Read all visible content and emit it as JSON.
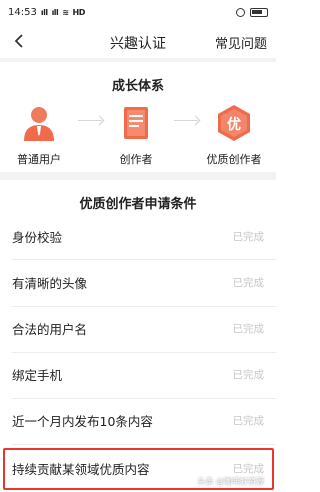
{
  "status_bar": {
    "time": "14:53",
    "signal_1": "ᵢll",
    "signal_2": "ᵢll",
    "network": "HD"
  },
  "nav": {
    "title": "兴趣认证",
    "faq": "常见问题"
  },
  "growth": {
    "title": "成长体系",
    "stages": [
      {
        "label": "普通用户",
        "icon": "user-icon"
      },
      {
        "label": "创作者",
        "icon": "book-icon"
      },
      {
        "label": "优质创作者",
        "icon": "quality-badge-icon",
        "badge_text": "优"
      }
    ]
  },
  "conditions": {
    "title": "优质创作者申请条件",
    "items": [
      {
        "label": "身份校验",
        "status": "已完成"
      },
      {
        "label": "有清晰的头像",
        "status": "已完成"
      },
      {
        "label": "合法的用户名",
        "status": "已完成"
      },
      {
        "label": "绑定手机",
        "status": "已完成"
      },
      {
        "label": "近一个月内发布10条内容",
        "status": "已完成"
      },
      {
        "label": "持续贡献某领域优质内容",
        "status": "已完成"
      }
    ]
  },
  "watermark": "头条 @咖啡好资源",
  "colors": {
    "accent_orange": "#ef6b4c",
    "highlight_red": "#e8362f",
    "muted_status": "#c7c7c7"
  }
}
